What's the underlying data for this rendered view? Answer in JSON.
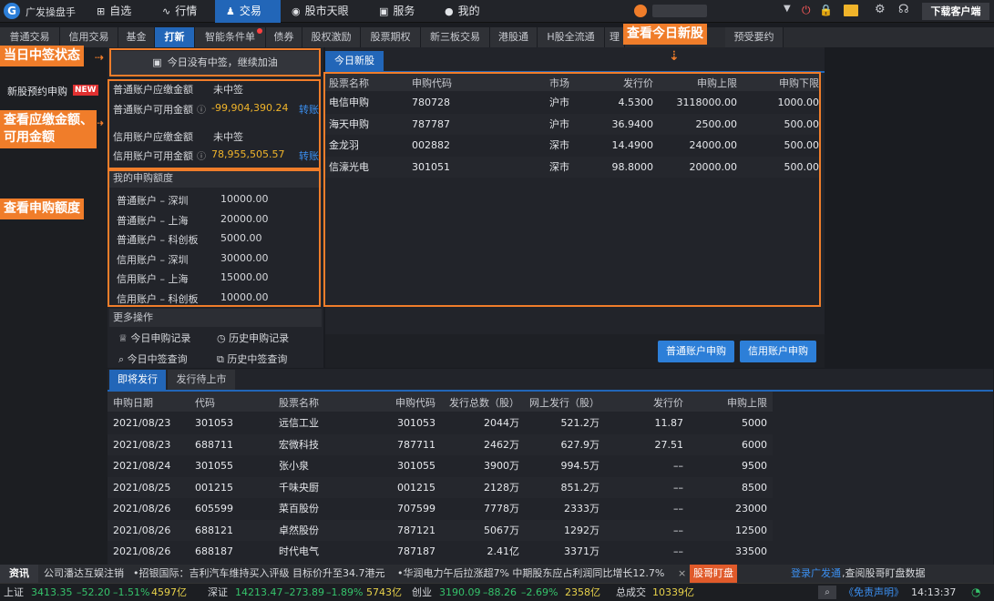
{
  "app": {
    "name": "广发操盘手",
    "logo": "G"
  },
  "top_nav": [
    {
      "label": "自选",
      "icon": "⊞"
    },
    {
      "label": "行情",
      "icon": "∿"
    },
    {
      "label": "交易",
      "icon": "♟"
    },
    {
      "label": "股市天眼",
      "icon": "◉"
    },
    {
      "label": "服务",
      "icon": "▣"
    },
    {
      "label": "我的",
      "icon": "●"
    }
  ],
  "top_right": {
    "user": " ",
    "download": "下载客户端"
  },
  "sub_tabs": [
    "普通交易",
    "信用交易",
    "基金",
    "打新",
    "智能条件单",
    "债券",
    "股权激励",
    "股票期权",
    "新三板交易",
    "港股通",
    "H股全流通",
    "理",
    "预受要约"
  ],
  "sidebar": {
    "item": "新股预约申购",
    "badge": "NEW"
  },
  "banner": {
    "text": "今日没有中签，继续加油"
  },
  "accounts": {
    "normal_due_label": "普通账户应缴金额",
    "normal_due_value": "未中签",
    "normal_avail_label": "普通账户可用金额",
    "normal_avail_value": "-99,904,390.24",
    "credit_due_label": "信用账户应缴金额",
    "credit_due_value": "未中签",
    "credit_avail_label": "信用账户可用金额",
    "credit_avail_value": "78,955,505.57",
    "transfer": "转账"
  },
  "quota": {
    "title": "我的申购额度",
    "rows": [
      {
        "label": "普通账户 – 深圳",
        "value": "10000.00"
      },
      {
        "label": "普通账户 – 上海",
        "value": "20000.00"
      },
      {
        "label": "普通账户 – 科创板",
        "value": "5000.00"
      },
      {
        "label": "信用账户 – 深圳",
        "value": "30000.00"
      },
      {
        "label": "信用账户 – 上海",
        "value": "15000.00"
      },
      {
        "label": "信用账户 – 科创板",
        "value": "10000.00"
      }
    ]
  },
  "more": {
    "title": "更多操作",
    "items": [
      "今日申购记录",
      "历史申购记录",
      "今日中签查询",
      "历史中签查询"
    ]
  },
  "today": {
    "tab": "今日新股",
    "headers": [
      "股票名称",
      "申购代码",
      "市场",
      "发行价",
      "申购上限",
      "申购下限"
    ],
    "rows": [
      [
        "电信申购",
        "780728",
        "沪市",
        "4.5300",
        "3118000.00",
        "1000.00"
      ],
      [
        "海天申购",
        "787787",
        "沪市",
        "36.9400",
        "2500.00",
        "500.00"
      ],
      [
        "金龙羽",
        "002882",
        "深市",
        "14.4900",
        "24000.00",
        "500.00"
      ],
      [
        "信濠光电",
        "301051",
        "深市",
        "98.8000",
        "20000.00",
        "500.00"
      ]
    ],
    "btn_normal": "普通账户申购",
    "btn_credit": "信用账户申购"
  },
  "upcoming": {
    "tabs": [
      "即将发行",
      "发行待上市"
    ],
    "headers": [
      "申购日期",
      "代码",
      "股票名称",
      "申购代码",
      "发行总数（股）",
      "网上发行（股）",
      "发行价",
      "申购上限"
    ],
    "rows": [
      [
        "2021/08/23",
        "301053",
        "远信工业",
        "301053",
        "2044万",
        "521.2万",
        "11.87",
        "5000"
      ],
      [
        "2021/08/23",
        "688711",
        "宏微科技",
        "787711",
        "2462万",
        "627.9万",
        "27.51",
        "6000"
      ],
      [
        "2021/08/24",
        "301055",
        "张小泉",
        "301055",
        "3900万",
        "994.5万",
        "––",
        "9500"
      ],
      [
        "2021/08/25",
        "001215",
        "千味央厨",
        "001215",
        "2128万",
        "851.2万",
        "––",
        "8500"
      ],
      [
        "2021/08/26",
        "605599",
        "菜百股份",
        "707599",
        "7778万",
        "2333万",
        "––",
        "23000"
      ],
      [
        "2021/08/26",
        "688121",
        "卓然股份",
        "787121",
        "5067万",
        "1292万",
        "––",
        "12500"
      ],
      [
        "2021/08/26",
        "688187",
        "时代电气",
        "787187",
        "2.41亿",
        "3371万",
        "––",
        "33500"
      ]
    ]
  },
  "callouts": {
    "status": "当日中签状态",
    "amount": "查看应缴金额、\n可用金额",
    "quota": "查看申购额度",
    "today": "查看今日新股"
  },
  "news": {
    "tag": "资讯",
    "items": [
      "公司潘达互娱注销",
      "•招银国际：吉利汽车维持买入评级 目标价升至34.7港元",
      "•华润电力午后拉涨超7% 中期股东应占利润同比增长12.7%"
    ],
    "promo": "股哥盯盘",
    "login": "登录广发通",
    "login_tail": ",查阅股哥盯盘数据"
  },
  "status": {
    "sh_label": "上证",
    "sh_val": "3413.35",
    "sh_chg": "–52.20",
    "sh_pct": "–1.51%",
    "sh_amt": "4597亿",
    "sz_label": "深证",
    "sz_val": "14213.47",
    "sz_chg": "–273.89",
    "sz_pct": "–1.89%",
    "sz_amt": "5743亿",
    "cy_label": "创业",
    "cy_val": "3190.09",
    "cy_chg": "–88.26",
    "cy_pct": "–2.69%",
    "cy_amt": "2358亿",
    "total_label": "总成交",
    "total_val": "10339亿",
    "disclaimer": "《免责声明》",
    "time": "14:13:37"
  }
}
